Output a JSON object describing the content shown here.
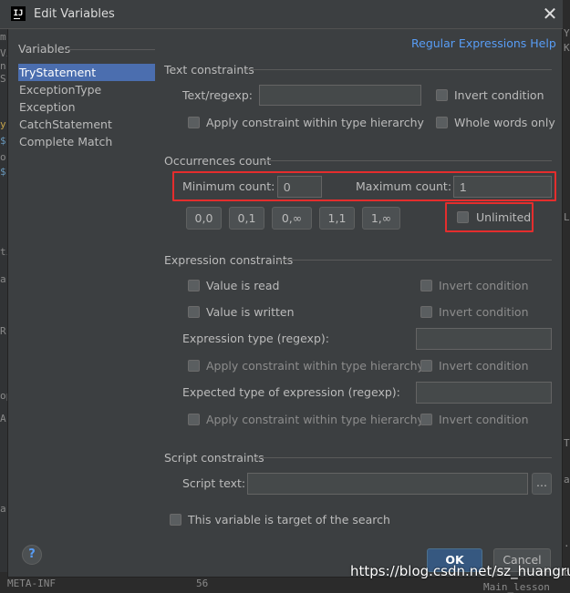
{
  "window": {
    "title": "Edit Variables",
    "app_icon_text": "IJ"
  },
  "help_link": "Regular Expressions Help",
  "variables": {
    "title": "Variables",
    "items": [
      "TryStatement",
      "ExceptionType",
      "Exception",
      "CatchStatement",
      "Complete Match"
    ],
    "selected": "TryStatement"
  },
  "text_constraints": {
    "title": "Text constraints",
    "regexp_label": "Text/regexp:",
    "regexp_value": "",
    "invert_condition": "Invert condition",
    "apply_hierarchy": "Apply constraint within type hierarchy",
    "whole_words": "Whole words only"
  },
  "occurrences": {
    "title": "Occurrences count",
    "min_label": "Minimum count:",
    "min_value": "0",
    "max_label": "Maximum count:",
    "max_value": "1",
    "presets": [
      "0,0",
      "0,1",
      "0,∞",
      "1,1",
      "1,∞"
    ],
    "unlimited": "Unlimited"
  },
  "expression_constraints": {
    "title": "Expression constraints",
    "value_read": "Value is read",
    "value_written": "Value is written",
    "invert_condition": "Invert condition",
    "expression_type_label": "Expression type (regexp):",
    "expression_type_value": "",
    "apply_hierarchy": "Apply constraint within type hierarchy",
    "expected_type_label": "Expected type of expression (regexp):",
    "expected_type_value": ""
  },
  "script_constraints": {
    "title": "Script constraints",
    "script_label": "Script text:",
    "script_value": "",
    "browse_label": "..."
  },
  "target_checkbox": "This variable is target of the search",
  "buttons": {
    "help": "?",
    "ok": "OK",
    "cancel": "Cancel"
  },
  "watermark": "https://blog.csdn.net/sz_huangrui",
  "background": {
    "left_fragments": [
      "m",
      "Vi",
      "n",
      "S",
      "y",
      "$",
      "o",
      "$",
      "ti",
      "a",
      "R",
      "op",
      "A",
      "a"
    ],
    "right_fragments": [
      "Y",
      "K",
      "L",
      "T",
      "a",
      ".",
      "b"
    ],
    "bottom_left": "META-INF",
    "bottom_mid": "56",
    "bottom_right": "Main_lesson"
  },
  "colors": {
    "selection": "#4b6eaf",
    "link": "#589df6",
    "highlight": "#e52d2d",
    "primary_button": "#365880"
  }
}
